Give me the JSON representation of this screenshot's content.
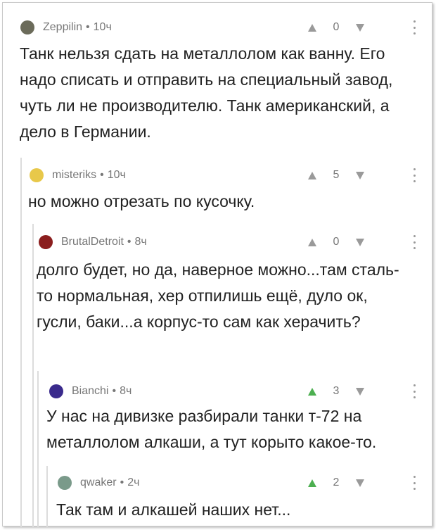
{
  "comments": [
    {
      "user": "Zeppilin",
      "time": "10ч",
      "score": "0",
      "upvoted": false,
      "avatar_color": "#6b6b5a",
      "text": "Танк нельзя сдать на металлолом как ванну. Его надо списать и отправить на специальный завод, чуть ли не производителю. Танк американский, а дело в Германии."
    },
    {
      "user": "misteriks",
      "time": "10ч",
      "score": "5",
      "upvoted": false,
      "avatar_color": "#e8c84a",
      "text": "но можно отрезать по кусочку."
    },
    {
      "user": "BrutalDetroit",
      "time": "8ч",
      "score": "0",
      "upvoted": false,
      "avatar_color": "#8b1e1e",
      "text": "долго будет, но да, наверное можно...там сталь-то нормальная, хер отпилишь ещё, дуло ок, гусли, баки...а корпус-то сам как херачить?"
    },
    {
      "user": "Bianchi",
      "time": "8ч",
      "score": "3",
      "upvoted": true,
      "avatar_color": "#3a2a8c",
      "text": "У нас на дивизке разбирали танки т-72 на металлолом алкаши, а тут корыто какое-то."
    },
    {
      "user": "qwaker",
      "time": "2ч",
      "score": "2",
      "upvoted": true,
      "avatar_color": "#7a9a8a",
      "text": "Так там и алкашей наших нет..."
    }
  ],
  "meta_separator": "•",
  "icons": {
    "upvote": "upvote-arrow-icon",
    "downvote": "downvote-arrow-icon",
    "more": "more-vertical-icon"
  }
}
